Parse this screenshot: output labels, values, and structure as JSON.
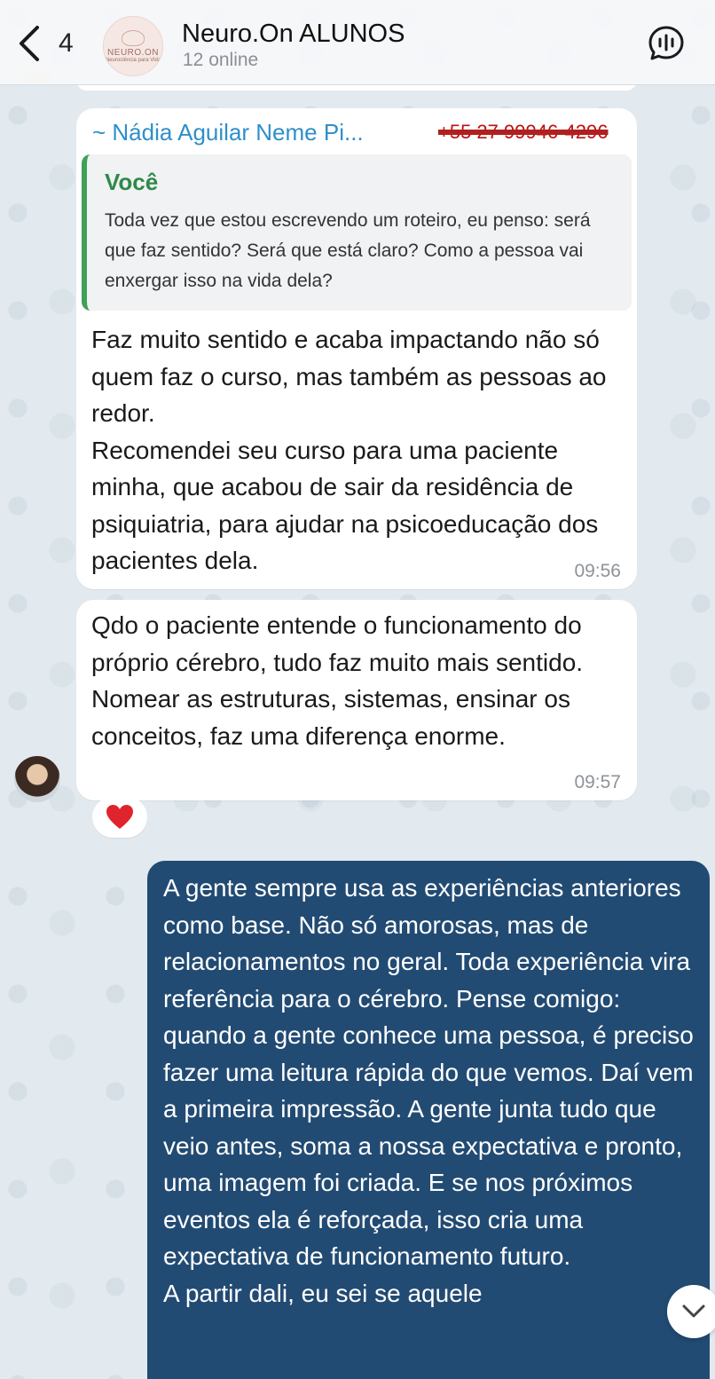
{
  "header": {
    "back_count": "4",
    "group_avatar_text": "NEURO.ON",
    "group_avatar_sub": "Neurociência para Vida",
    "title": "Neuro.On ALUNOS",
    "subtitle": "12 online"
  },
  "messages": [
    {
      "sender": "~ Nádia Aguilar Neme Pi...",
      "sender_phone": "+55 27 99946-4296",
      "reply_to": {
        "author": "Você",
        "text": "Toda vez que estou escrevendo um roteiro, eu penso: será que faz sentido? Será que está claro? Como a pessoa vai enxergar isso na vida dela?"
      },
      "text": "Faz muito sentido e acaba impactando não só quem faz o curso, mas também as pessoas ao redor.\n Recomendei seu curso para uma paciente minha, que acabou de sair da residência de psiquiatria, para ajudar na psicoeducação dos pacientes dela.",
      "time": "09:56"
    },
    {
      "text": "Qdo o paciente entende o funcionamento do próprio cérebro, tudo faz muito mais sentido. Nomear as estruturas, sistemas, ensinar os conceitos, faz uma diferença enorme.",
      "time": "09:57",
      "reaction": "heart"
    },
    {
      "text": "A gente sempre usa as experiências anteriores como base. Não só amorosas, mas de relacionamentos no geral. Toda experiência vira referência para o cérebro. Pense comigo: quando a gente conhece uma pessoa, é preciso fazer uma leitura rápida do que vemos. Daí vem a primeira impressão. A gente junta tudo que veio antes, soma a nossa expectativa e pronto, uma imagem foi criada. E se nos próximos eventos ela é reforçada, isso cria uma expectativa de funcionamento futuro.\nA partir dali, eu sei se aquele"
    }
  ],
  "colors": {
    "outgoing_bubble": "#224b73",
    "incoming_bubble": "#ffffff",
    "sender_name": "#2f8fc9",
    "reply_bar": "#3fa05a"
  }
}
